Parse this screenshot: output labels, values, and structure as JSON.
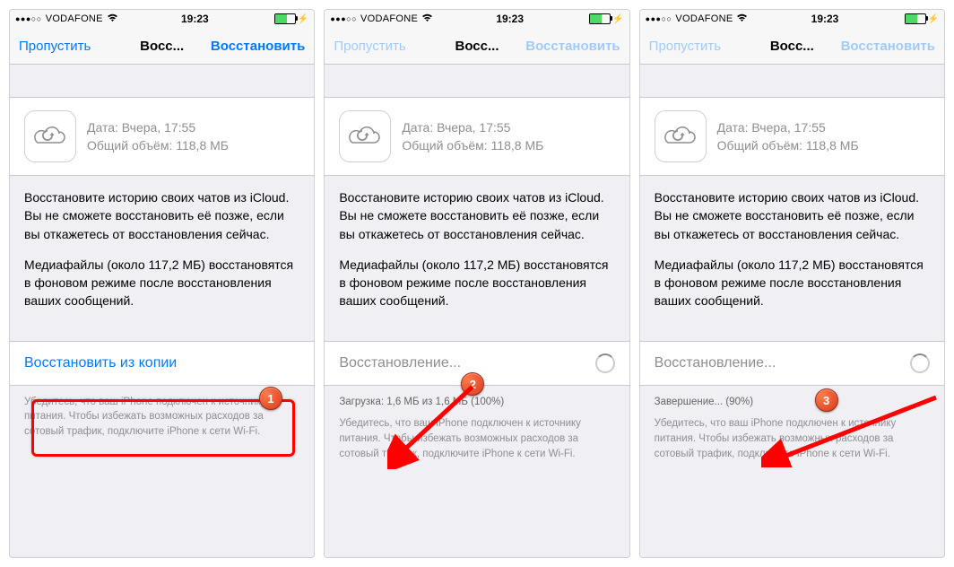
{
  "status": {
    "carrier": "VODAFONE",
    "time": "19:23"
  },
  "nav": {
    "skip": "Пропустить",
    "title": "Восс...",
    "restore": "Восстановить"
  },
  "card": {
    "date": "Дата: Вчера, 17:55",
    "size": "Общий объём: 118,8 МБ"
  },
  "para1": "Восстановите историю своих чатов из iCloud. Вы не сможете восстановить её позже, если вы откажетесь от восстановления сейчас.",
  "para2": "Медиафайлы (около 117,2 МБ) восстановятся в фоновом режиме после восстановления ваших сообщений.",
  "action": {
    "p1": "Восстановить из копии",
    "p2": "Восстановление...",
    "p3": "Восстановление..."
  },
  "status2": {
    "p2": "Загрузка: 1,6 МБ из 1,6 МБ (100%)",
    "p3": "Завершение... (90%)"
  },
  "footer": "Убедитесь, что ваш iPhone подключен к источнику питания. Чтобы избежать возможных расходов за сотовый трафик, подключите iPhone к сети Wi-Fi.",
  "badges": {
    "b1": "1",
    "b2": "2",
    "b3": "3"
  }
}
